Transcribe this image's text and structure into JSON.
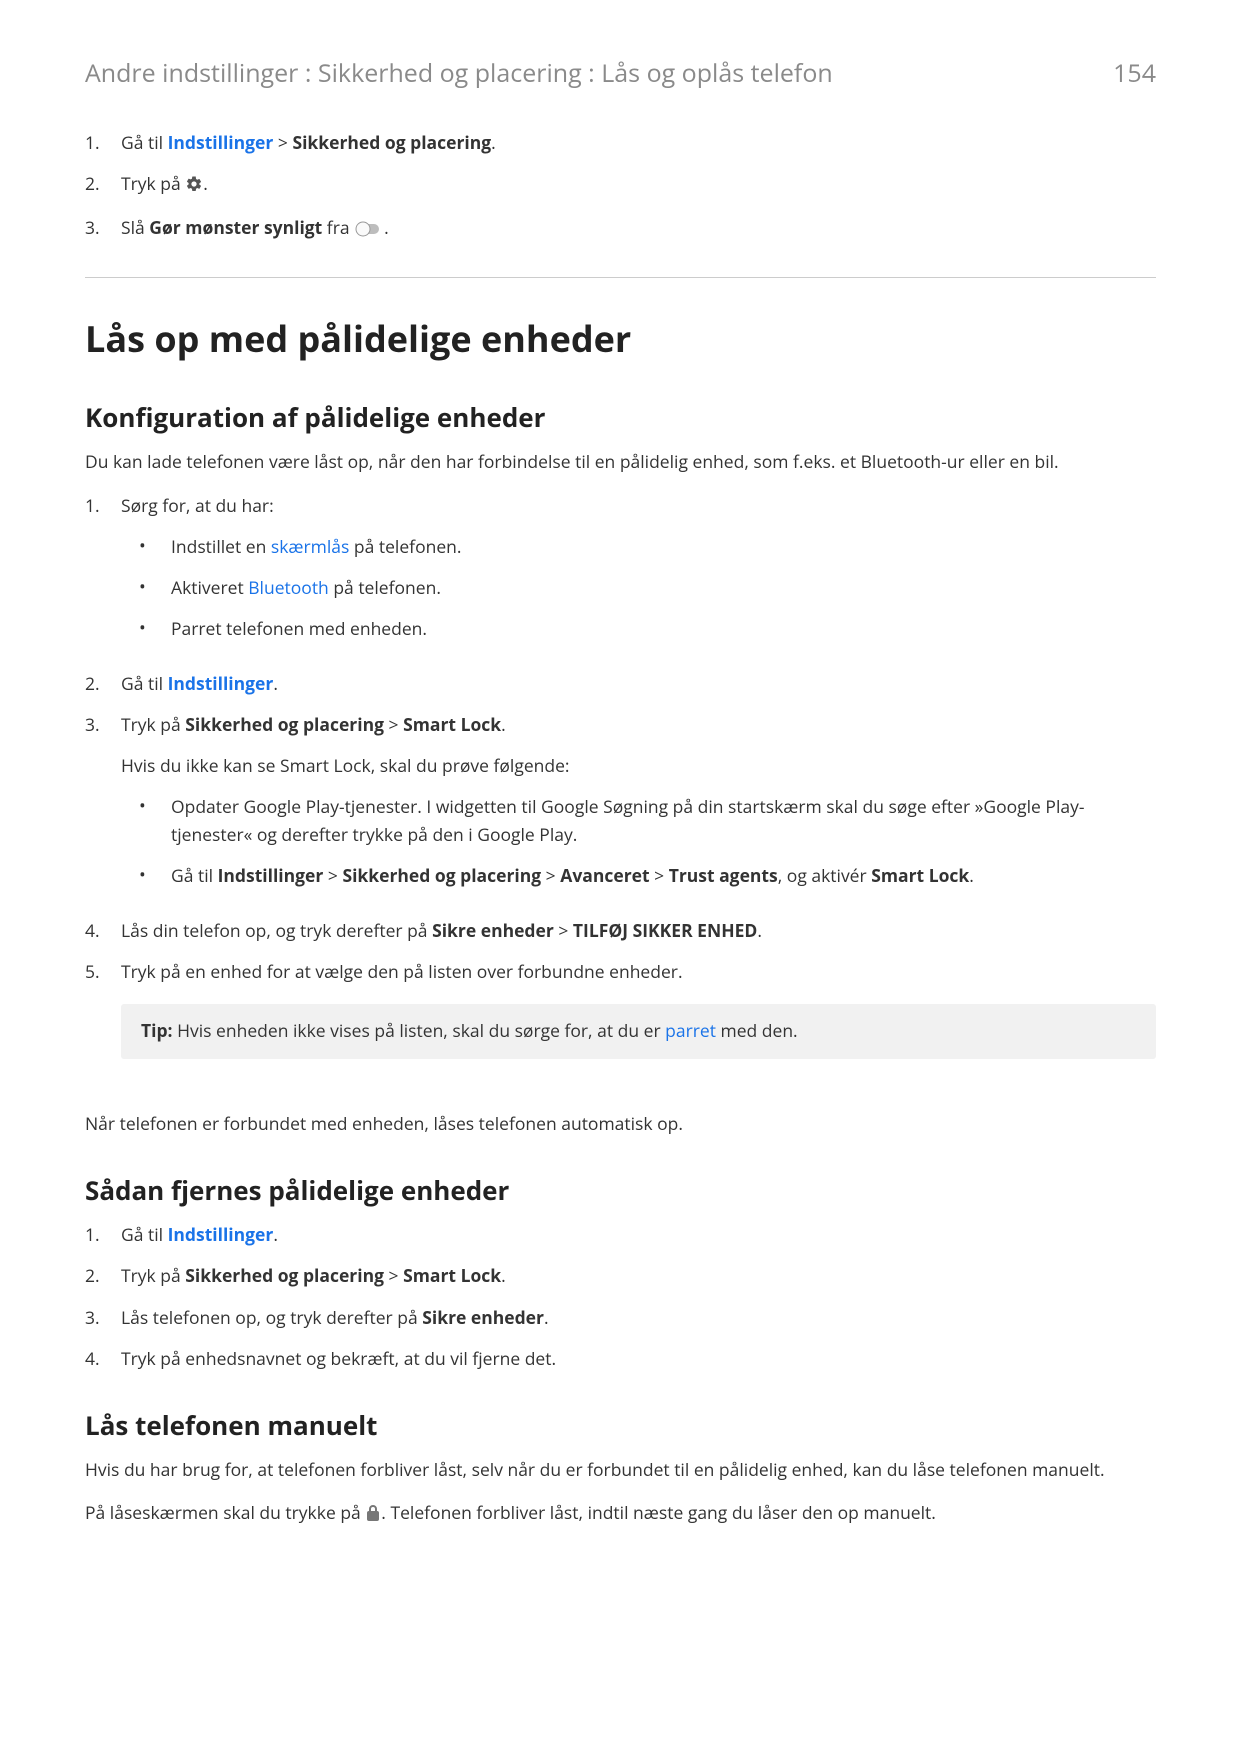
{
  "header": {
    "breadcrumb": "Andre indstillinger : Sikkerhed og placering : Lås og oplås telefon",
    "page_number": "154"
  },
  "top_steps": {
    "s1_num": "1.",
    "s1_pre": "Gå til ",
    "s1_link": "Indstillinger",
    "s1_gt": " > ",
    "s1_bold": "Sikkerhed og placering",
    "s1_end": ".",
    "s2_num": "2.",
    "s2_pre": "Tryk på ",
    "s2_end": ".",
    "s3_num": "3.",
    "s3_pre": "Slå ",
    "s3_bold": "Gør mønster synligt",
    "s3_mid": " fra ",
    "s3_end": "."
  },
  "h1": "Lås op med pålidelige enheder",
  "sec1": {
    "h2": "Konfiguration af pålidelige enheder",
    "intro": "Du kan lade telefonen være låst op, når den har forbindelse til en pålidelig enhed, som f.eks. et Bluetooth-ur eller en bil.",
    "s1_num": "1.",
    "s1_text": "Sørg for, at du har:",
    "s1_b1_pre": "Indstillet en ",
    "s1_b1_link": "skærmlås",
    "s1_b1_post": " på telefonen.",
    "s1_b2_pre": "Aktiveret ",
    "s1_b2_link": "Bluetooth",
    "s1_b2_post": " på telefonen.",
    "s1_b3": "Parret telefonen med enheden.",
    "s2_num": "2.",
    "s2_pre": "Gå til ",
    "s2_link": "Indstillinger",
    "s2_end": ".",
    "s3_num": "3.",
    "s3_pre": "Tryk på ",
    "s3_b1": "Sikkerhed og placering",
    "s3_gt": " > ",
    "s3_b2": "Smart Lock",
    "s3_end": ".",
    "s3_note": "Hvis du ikke kan se Smart Lock, skal du prøve følgende:",
    "s3_sub1": "Opdater Google Play-tjenester. I widgetten til Google Søgning på din startskærm skal du søge efter »Google Play-tjenester« og derefter trykke på den i Google Play.",
    "s3_sub2_pre": "Gå til ",
    "s3_sub2_b1": "Indstillinger",
    "s3_sub2_b2": "Sikkerhed og placering",
    "s3_sub2_b3": "Avanceret",
    "s3_sub2_b4": "Trust agents",
    "s3_sub2_mid": ", og aktivér ",
    "s3_sub2_b5": "Smart Lock",
    "s3_sub2_end": ".",
    "s4_num": "4.",
    "s4_pre": "Lås din telefon op, og tryk derefter på ",
    "s4_b1": "Sikre enheder",
    "s4_gt": " > ",
    "s4_b2": "TILFØJ SIKKER ENHED",
    "s4_end": ".",
    "s5_num": "5.",
    "s5_text": "Tryk på en enhed for at vælge den på listen over forbundne enheder.",
    "tip_label": "Tip:",
    "tip_pre": " Hvis enheden ikke vises på listen, skal du sørge for, at du er ",
    "tip_link": "parret",
    "tip_post": " med den.",
    "outro": "Når telefonen er forbundet med enheden, låses telefonen automatisk op."
  },
  "sec2": {
    "h2": "Sådan fjernes pålidelige enheder",
    "s1_num": "1.",
    "s1_pre": "Gå til ",
    "s1_link": "Indstillinger",
    "s1_end": ".",
    "s2_num": "2.",
    "s2_pre": "Tryk på ",
    "s2_b1": "Sikkerhed og placering",
    "s2_gt": " > ",
    "s2_b2": "Smart Lock",
    "s2_end": ".",
    "s3_num": "3.",
    "s3_pre": "Lås telefonen op, og tryk derefter på ",
    "s3_b1": "Sikre enheder",
    "s3_end": ".",
    "s4_num": "4.",
    "s4_text": "Tryk på enhedsnavnet og bekræft, at du vil fjerne det."
  },
  "sec3": {
    "h2": "Lås telefonen manuelt",
    "intro": "Hvis du har brug for, at telefonen forbliver låst, selv når du er forbundet til en pålidelig enhed, kan du låse telefonen manuelt.",
    "p2_pre": "På låseskærmen skal du trykke på ",
    "p2_post": ". Telefonen forbliver låst, indtil næste gang du låser den op manuelt."
  }
}
